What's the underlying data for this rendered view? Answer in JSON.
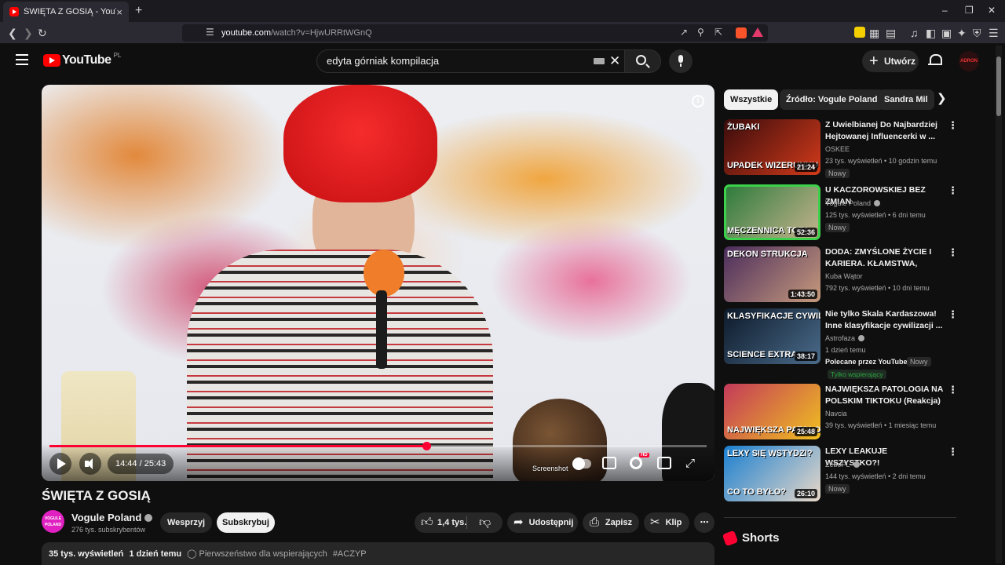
{
  "browser": {
    "tab_title": "ŚWIĘTA Z GOSIĄ - YouTube",
    "tab_close": "×",
    "new_tab": "+",
    "url_host": "youtube.com",
    "url_path": "/watch?v=HjwURRtWGnQ",
    "window_controls": [
      "–",
      "❐",
      "✕"
    ]
  },
  "header": {
    "logo_text": "YouTube",
    "country_code": "PL",
    "search_value": "edyta górniak  kompilacja",
    "create_label": "Utwórz",
    "avatar_text": "ADRON"
  },
  "player": {
    "current_time": "14:44",
    "duration": "25:43",
    "time_display": "14:44 / 25:43",
    "progress_fraction": 0.573,
    "screenshot_label": "Screenshot",
    "hd_badge": "HD"
  },
  "video": {
    "title": "ŚWIĘTA Z GOSIĄ",
    "channel_name": "Vogule Poland",
    "channel_avatar_text": "VOGULE POLAND",
    "subscribers": "276 tys. subskrybentów",
    "support_label": "Wesprzyj",
    "subscribe_label": "Subskrybuj",
    "likes": "1,4 tys.",
    "share_label": "Udostępnij",
    "save_label": "Zapisz",
    "clip_label": "Klip",
    "more_label": "⋯",
    "views": "35 tys. wyświetleń",
    "upload_time": "1 dzień temu",
    "priority_text": "Pierwszeństwo dla wspierających",
    "hashtag": "#ACZYP"
  },
  "chips": [
    {
      "label": "Wszystkie",
      "active": true
    },
    {
      "label": "Źródło: Vogule Poland",
      "active": false
    },
    {
      "label": "Sandra Mil",
      "active": false
    }
  ],
  "recommendations": [
    {
      "title": "Z Uwielbianej Do Najbardziej Hejtowanej Influencerki w ...",
      "channel": "OSKEE",
      "verified": false,
      "stats": "23 tys. wyświetleń • 10 godzin temu",
      "duration": "21:24",
      "badge": "Nowy",
      "thumb_caption_top": "ŻUBAKI",
      "thumb_caption": "UPADEK WIZERUNKU JULI",
      "thumb_colors": [
        "#3a0c0c",
        "#d23a1a"
      ]
    },
    {
      "title": "U KACZOROWSKIEJ BEZ ZMIAN",
      "channel": "Vogule Poland",
      "verified": true,
      "stats": "125 tys. wyświetleń • 6 dni temu",
      "duration": "52:36",
      "badge": "Nowy",
      "thumb_caption": "MĘCZENNICA TOTA",
      "thumb_colors": [
        "#2a7a3a",
        "#c9b48f"
      ]
    },
    {
      "title": "DODA: ZMYŚLONE ŻYCIE I KARIERA. KŁAMSTWA, AFERY,...",
      "channel": "Kuba Wątor",
      "verified": false,
      "stats": "792 tys. wyświetleń • 10 dni temu",
      "duration": "1:43:50",
      "thumb_caption_top": "DEKON STRUKCJA",
      "thumb_colors": [
        "#4a2c5c",
        "#c79a7c"
      ]
    },
    {
      "title": "Nie tylko Skala Kardaszowa! Inne klasyfikacje cywilizacji ...",
      "channel": "Astrofaza",
      "verified": true,
      "stats": "1 dzień temu",
      "duration": "38:17",
      "promoted": "Polecane przez YouTube",
      "badge": "Nowy",
      "member_badge": "Tylko wspierający",
      "thumb_caption_top": "KLASYFIKACJE CYWILIZACJI",
      "thumb_caption": "SCIENCE EXTRA",
      "thumb_colors": [
        "#0d1a2a",
        "#4a6b8a"
      ]
    },
    {
      "title": "NAJWIĘKSZA PATOLOGIA NA POLSKIM TIKTOKU (Reakcja)",
      "channel": "Navcia",
      "verified": false,
      "stats": "39 tys. wyświetleń • 1 miesiąc temu",
      "duration": "25:48",
      "thumb_caption": "NAJWIĘKSZA PATOLOGIA",
      "thumb_colors": [
        "#c33a5a",
        "#f0c020"
      ]
    },
    {
      "title": "LEXY LEAKUJE WSZYSTKO?!",
      "channel": "ZeboPL",
      "verified": true,
      "stats": "144 tys. wyświetleń • 2 dni temu",
      "duration": "26:10",
      "badge": "Nowy",
      "thumb_caption_top": "LEXY SIĘ WSTYDZI?",
      "thumb_caption": "CO TO BYŁO?",
      "thumb_colors": [
        "#1a7fd0",
        "#e8d8c8"
      ]
    }
  ],
  "shorts": {
    "title": "Shorts"
  },
  "colors": {
    "brand_red": "#ff0000",
    "progress_red": "#ff0033",
    "background": "#0f0f0f"
  }
}
